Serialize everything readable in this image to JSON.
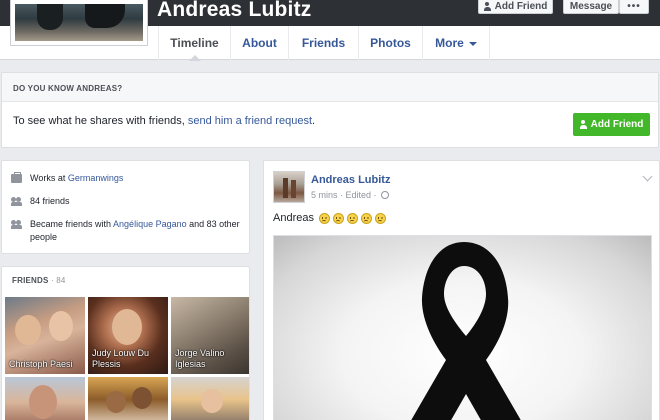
{
  "profile": {
    "name": "Andreas Lubitz"
  },
  "header_buttons": {
    "add_friend": "Add Friend",
    "message": "Message",
    "more": "•••"
  },
  "tabs": [
    {
      "label": "Timeline",
      "active": true
    },
    {
      "label": "About"
    },
    {
      "label": "Friends"
    },
    {
      "label": "Photos"
    },
    {
      "label": "More"
    }
  ],
  "do_you_know": {
    "heading": "DO YOU KNOW ANDREAS?",
    "text_before": "To see what he shares with friends, ",
    "link": "send him a friend request",
    "text_after": ".",
    "button": "Add Friend"
  },
  "intro": {
    "works_prefix": "Works at ",
    "works_link": "Germanwings",
    "friends_count": "84 friends",
    "became_prefix": "Became friends with ",
    "became_link": "Angélique Pagano",
    "became_suffix": " and 83 other people"
  },
  "friends_section": {
    "heading": "FRIENDS",
    "separator": " · ",
    "count": "84",
    "tiles": [
      {
        "name": "Christoph Paesi"
      },
      {
        "name": "Judy Louw Du Plessis"
      },
      {
        "name": "Jorge Valino Iglesias"
      },
      {
        "name": ""
      },
      {
        "name": ""
      },
      {
        "name": ""
      }
    ]
  },
  "post": {
    "author": "Andreas Lubitz",
    "meta": "5 mins · Edited · ",
    "text": "Andreas",
    "emoji_count": 5
  },
  "colors": {
    "link": "#365899",
    "green_button": "#42b72a",
    "cover": "#2d3136",
    "page_bg": "#e9ebee"
  }
}
